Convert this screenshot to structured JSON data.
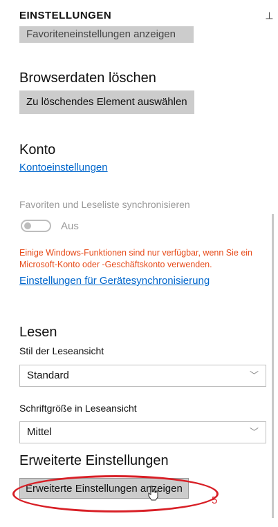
{
  "header": {
    "title": "EINSTELLUNGEN",
    "pin_icon": "pin-icon"
  },
  "cut_button": {
    "label": "Favoriteneinstellungen anzeigen"
  },
  "browser_data": {
    "title": "Browserdaten löschen",
    "button": "Zu löschendes Element auswählen"
  },
  "account": {
    "title": "Konto",
    "link": "Kontoeinstellungen"
  },
  "sync": {
    "label": "Favoriten und Leseliste synchronisieren",
    "toggle_state": "Aus",
    "warning": "Einige Windows-Funktionen sind nur verfügbar, wenn Sie ein Microsoft-Konto oder -Geschäftskonto verwenden.",
    "link": "Einstellungen für Gerätesynchronisierung"
  },
  "reading": {
    "title": "Lesen",
    "style_label": "Stil der Leseansicht",
    "style_value": "Standard",
    "size_label": "Schriftgröße in Leseansicht",
    "size_value": "Mittel"
  },
  "advanced": {
    "title": "Erweiterte Einstellungen",
    "button": "Erweiterte Einstellungen anzeigen"
  },
  "annotation": {
    "number": "5",
    "color": "#d81f26"
  },
  "colors": {
    "link": "#0066cc",
    "warning": "#e64a19",
    "button": "#cccccc"
  }
}
